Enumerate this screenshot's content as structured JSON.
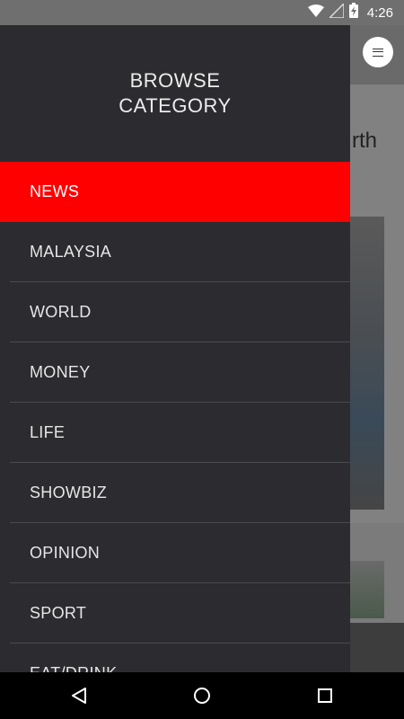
{
  "status_bar": {
    "time": "4:26",
    "icons": [
      "wifi-icon",
      "signal-icon",
      "battery-charging-icon"
    ]
  },
  "background": {
    "headline_fragment": "rth"
  },
  "drawer": {
    "title": "BROWSE CATEGORY",
    "items": [
      {
        "label": "NEWS",
        "active": true
      },
      {
        "label": "MALAYSIA",
        "active": false
      },
      {
        "label": "WORLD",
        "active": false
      },
      {
        "label": "MONEY",
        "active": false
      },
      {
        "label": "LIFE",
        "active": false
      },
      {
        "label": "SHOWBIZ",
        "active": false
      },
      {
        "label": "OPINION",
        "active": false
      },
      {
        "label": "SPORT",
        "active": false
      },
      {
        "label": "EAT/DRINK",
        "active": false
      }
    ]
  },
  "colors": {
    "drawer_bg": "#2b2b30",
    "active_item": "#ff0000",
    "text": "#e6e6e6"
  },
  "navigation_bar": {
    "icons": [
      "back-icon",
      "home-icon",
      "recents-icon"
    ]
  }
}
